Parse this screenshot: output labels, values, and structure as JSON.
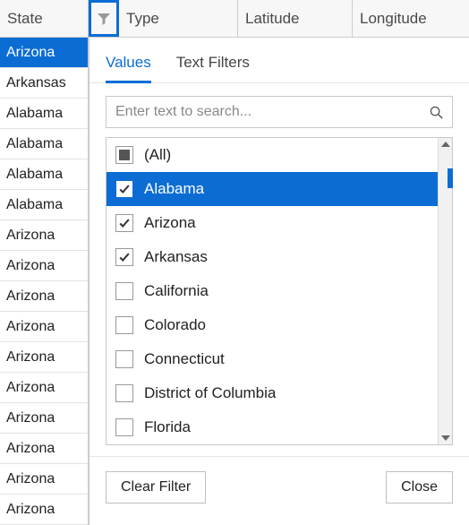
{
  "columns": {
    "state": "State",
    "type": "Type",
    "latitude": "Latitude",
    "longitude": "Longitude"
  },
  "state_values": [
    {
      "label": "Arizona",
      "selected": true
    },
    {
      "label": "Arkansas",
      "selected": false
    },
    {
      "label": "Alabama",
      "selected": false
    },
    {
      "label": "Alabama",
      "selected": false
    },
    {
      "label": "Alabama",
      "selected": false
    },
    {
      "label": "Alabama",
      "selected": false
    },
    {
      "label": "Arizona",
      "selected": false
    },
    {
      "label": "Arizona",
      "selected": false
    },
    {
      "label": "Arizona",
      "selected": false
    },
    {
      "label": "Arizona",
      "selected": false
    },
    {
      "label": "Arizona",
      "selected": false
    },
    {
      "label": "Arizona",
      "selected": false
    },
    {
      "label": "Arizona",
      "selected": false
    },
    {
      "label": "Arizona",
      "selected": false
    },
    {
      "label": "Arizona",
      "selected": false
    },
    {
      "label": "Arizona",
      "selected": false
    }
  ],
  "filter_popup": {
    "tabs": {
      "values": "Values",
      "text_filters": "Text Filters"
    },
    "search_placeholder": "Enter text to search...",
    "items": [
      {
        "label": "(All)",
        "state": "indeterminate",
        "selected": false
      },
      {
        "label": "Alabama",
        "state": "checked",
        "selected": true
      },
      {
        "label": "Arizona",
        "state": "checked",
        "selected": false
      },
      {
        "label": "Arkansas",
        "state": "checked",
        "selected": false
      },
      {
        "label": "California",
        "state": "unchecked",
        "selected": false
      },
      {
        "label": "Colorado",
        "state": "unchecked",
        "selected": false
      },
      {
        "label": "Connecticut",
        "state": "unchecked",
        "selected": false
      },
      {
        "label": "District of Columbia",
        "state": "unchecked",
        "selected": false
      },
      {
        "label": "Florida",
        "state": "unchecked",
        "selected": false
      }
    ],
    "buttons": {
      "clear": "Clear Filter",
      "close": "Close"
    }
  }
}
